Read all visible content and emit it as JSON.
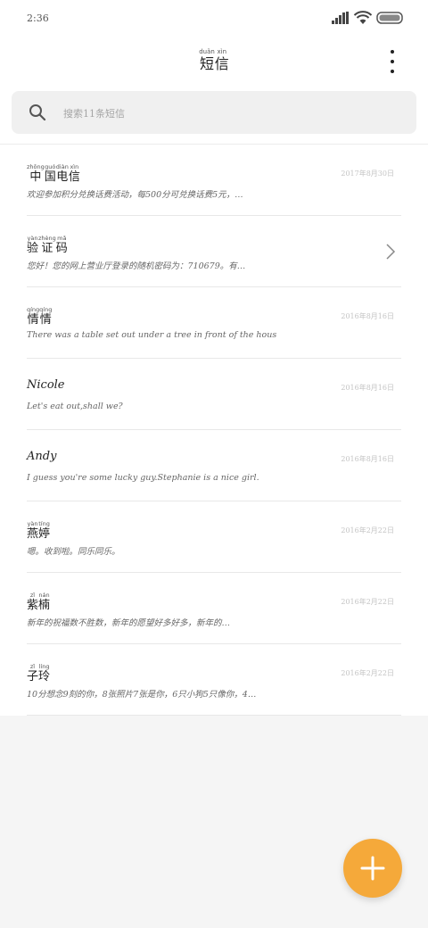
{
  "status": {
    "time": "2:36"
  },
  "header": {
    "title_chars": [
      [
        "短",
        "duǎn"
      ],
      [
        "信",
        "xìn"
      ]
    ]
  },
  "search": {
    "placeholder": "搜索11条短信"
  },
  "messages": [
    {
      "name": "中国电信",
      "name_pinyin": [
        "zhōng",
        "guó",
        "diàn",
        "xìn"
      ],
      "preview": "欢迎参加积分兑换话费活动，每500分可兑换话费5元，…",
      "date": "2017年8月30日"
    },
    {
      "name": "验证码",
      "name_pinyin": [
        "yàn",
        "zhèng",
        "mǎ"
      ],
      "preview": "您好！您的网上营业厅登录的随机密码为：710679。有…",
      "date": ""
    },
    {
      "name": "情情",
      "name_pinyin": [
        "qíng",
        "qíng"
      ],
      "preview": "There was a table set out under a tree in front of the hous",
      "date": "2016年8月16日"
    },
    {
      "name": "Nicole",
      "name_pinyin": [],
      "preview": "Let's eat out,shall we?",
      "date": "2016年8月16日"
    },
    {
      "name": "Andy",
      "name_pinyin": [],
      "preview": "I guess you're some lucky guy.Stephanie is a nice girl.",
      "date": "2016年8月16日"
    },
    {
      "name": "燕婷",
      "name_pinyin": [
        "yàn",
        "tíng"
      ],
      "preview": "嗯。收到啦。同乐同乐。",
      "date": "2016年2月22日"
    },
    {
      "name": "紫楠",
      "name_pinyin": [
        "zǐ",
        "nán"
      ],
      "preview": "新年的祝福数不胜数，新年的愿望好多好多，新年的…",
      "date": "2016年2月22日"
    },
    {
      "name": "子玲",
      "name_pinyin": [
        "zǐ",
        "líng"
      ],
      "preview": "10分想念9刻的你，8张照片7张是你，6只小狗5只像你，4…",
      "date": "2016年2月22日"
    }
  ],
  "colors": {
    "accent": "#f5a93a",
    "background": "#f5f5f5",
    "divider": "#e8e8e8"
  },
  "icons": {
    "search": "search-icon",
    "menu": "more-vertical-icon",
    "chevron": "chevron-right-icon",
    "compose": "plus-icon"
  }
}
